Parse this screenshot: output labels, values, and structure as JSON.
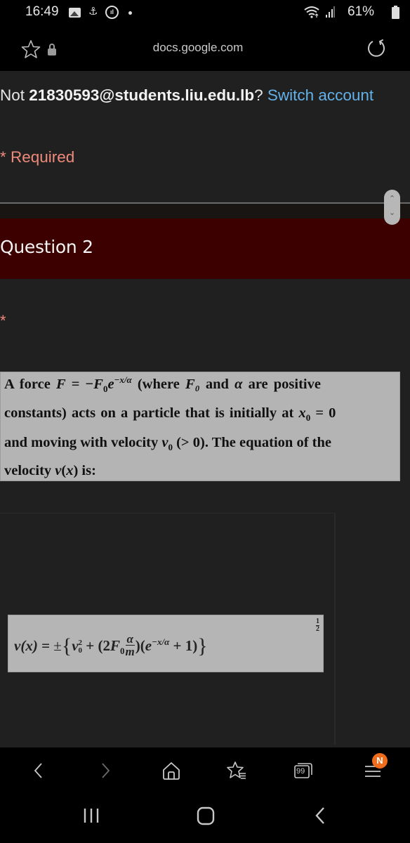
{
  "status_bar": {
    "time": "16:49",
    "battery": "61%",
    "icons": [
      "gallery-icon",
      "anchor-icon",
      "audio-icon",
      "dot-icon",
      "wifi-icon",
      "signal-icon",
      "battery-charging-icon"
    ]
  },
  "browser": {
    "url": "docs.google.com",
    "icons": [
      "star-icon",
      "lock-icon",
      "reload-icon"
    ]
  },
  "form": {
    "account_prefix": "Not ",
    "account_email": "21830593@students.liu.edu.lb",
    "account_suffix": "? ",
    "switch_account_label": "Switch account",
    "required_note": "* Required",
    "section_title": "Question 2",
    "required_marker": "*",
    "colors": {
      "section_header_bg": "#3c0000",
      "link": "#63b1e8",
      "required": "#ef8a7c",
      "badge": "#ee6c1b"
    }
  },
  "question": {
    "line1_a": "A force ",
    "line1_formula_F": "F",
    "line1_eq": " = −",
    "line1_F0": "F",
    "line1_F0_sub": "0",
    "line1_e": "e",
    "line1_exp": "−x/α",
    "line1_b": " (where ",
    "line1_F0b": "F₀",
    "line1_c": " and ",
    "line1_alpha": "α",
    "line1_d": " are positive",
    "line2_a": "constants) acts on a particle that is initially at  ",
    "line2_x": "x",
    "line2_x_sub": "0",
    "line2_b": " = 0",
    "line3_a": "and moving with velocity ",
    "line3_v": "v",
    "line3_v_sub": "0",
    "line3_b": " (> 0). The equation of the",
    "line4_a": "velocity ",
    "line4_v": "v",
    "line4_b": "(",
    "line4_x": "x",
    "line4_c": ") is:"
  },
  "answer_option": {
    "lhs": "v(x) = ",
    "pm": "±",
    "brace_open": "{",
    "v0": "v",
    "v0_sup": "2",
    "v0_sub": "0",
    "plus1": " + (2",
    "F0": "F",
    "F0_sub": "0",
    "frac_num": "α",
    "frac_den": "m",
    "close_paren": ")",
    "e_open": "(",
    "e": "e",
    "e_exp": "−x/α",
    "plus2": " + 1)",
    "brace_close": "}",
    "power_num": "1",
    "power_den": "2"
  },
  "toolbar": {
    "items": [
      "back-button",
      "forward-button",
      "home-button",
      "bookmarks-button",
      "tabs-button",
      "menu-button"
    ],
    "tabs_count": "99",
    "menu_badge": "N"
  },
  "nav_bar": {
    "items": [
      "recent-apps-button",
      "home-nav-button",
      "back-nav-button"
    ]
  }
}
